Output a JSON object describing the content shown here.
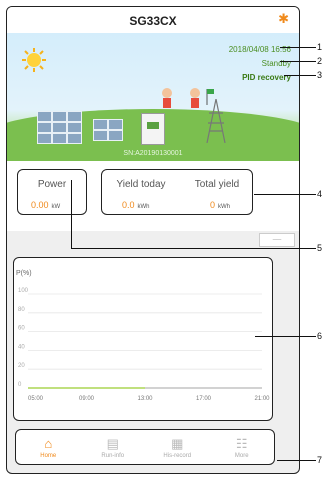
{
  "header": {
    "title": "SG33CX",
    "bluetooth_icon": "bluetooth-icon"
  },
  "hero": {
    "datetime": "2018/04/08 16:56",
    "status": "Standby",
    "pid": "PID recovery",
    "sn": "SN:A20190130001"
  },
  "stats": {
    "power": {
      "label": "Power",
      "value": "0.00",
      "unit": "kW"
    },
    "yield_today": {
      "label": "Yield today",
      "value": "0.0",
      "unit": "kWh"
    },
    "total_yield": {
      "label": "Total yield",
      "value": "0",
      "unit": "kWh"
    }
  },
  "chart_data": {
    "type": "line",
    "ylabel": "P(%)",
    "yticks": [
      "100",
      "80",
      "60",
      "40",
      "20",
      "0"
    ],
    "categories": [
      "05:00",
      "09:00",
      "13:00",
      "17:00",
      "21:00"
    ],
    "ylim": [
      0,
      100
    ],
    "series": [
      {
        "values": [
          0,
          0,
          0
        ]
      }
    ]
  },
  "tabs": [
    {
      "label": "Home",
      "icon": "home-icon"
    },
    {
      "label": "Run-info",
      "icon": "run-info-icon"
    },
    {
      "label": "His-record",
      "icon": "his-record-icon"
    },
    {
      "label": "More",
      "icon": "more-icon"
    }
  ],
  "callouts": [
    "1",
    "2",
    "3",
    "4",
    "5",
    "6",
    "7"
  ],
  "colors": {
    "accent": "#f08a1c",
    "green_text": "#4b8e22",
    "plot_line": "#9acd32"
  }
}
